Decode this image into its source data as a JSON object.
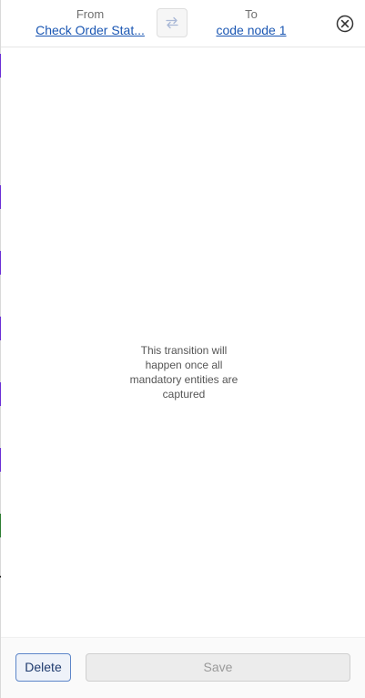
{
  "header": {
    "from": {
      "label": "From",
      "node": "Check Order Stat..."
    },
    "to": {
      "label": "To",
      "node": "code node 1"
    },
    "swap_icon": "swap-arrows-icon",
    "close_icon": "close-circle-icon"
  },
  "body": {
    "message": "This transition will happen once all mandatory entities are captured"
  },
  "footer": {
    "delete_label": "Delete",
    "save_label": "Save",
    "save_disabled": true
  },
  "colors": {
    "link": "#1b57b3",
    "canvas_edge_purple": "#6b2fd6",
    "canvas_edge_green": "#2e7d32"
  }
}
